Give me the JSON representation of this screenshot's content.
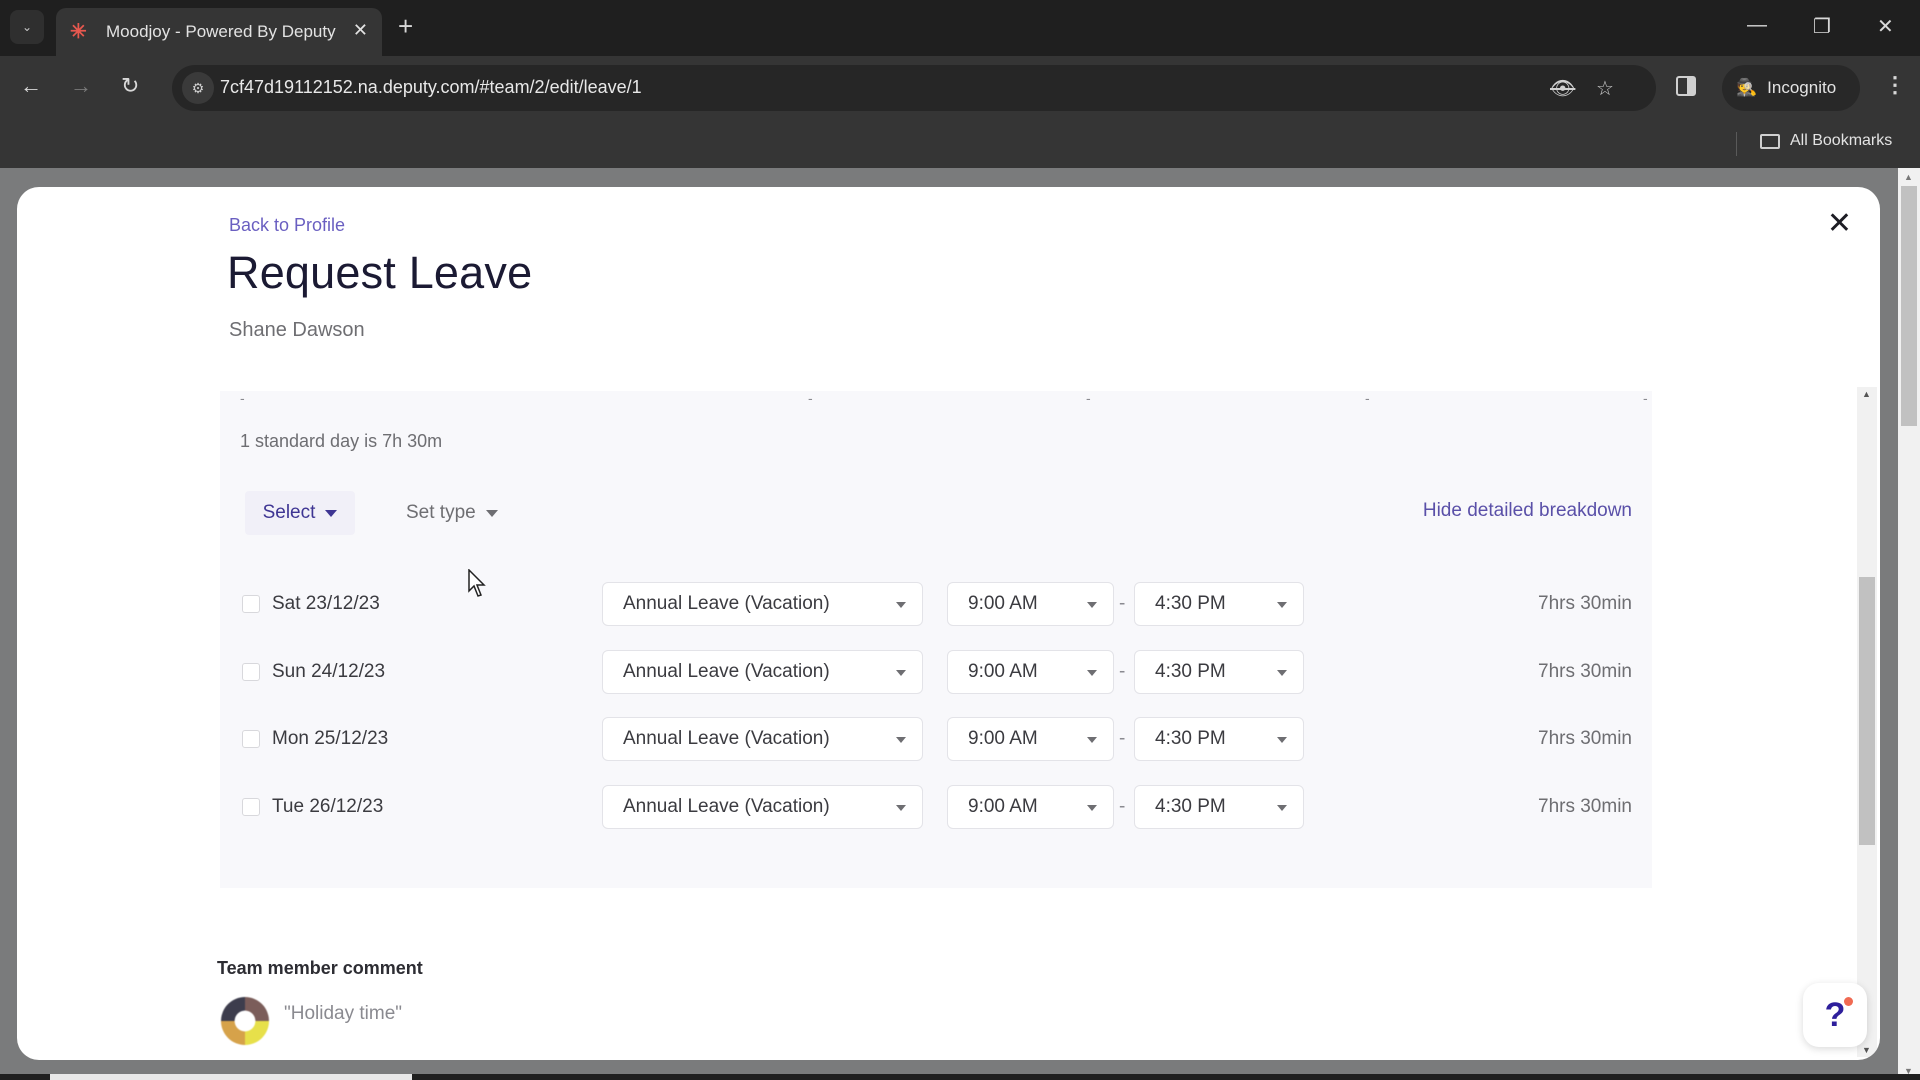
{
  "browser": {
    "tab_title": "Moodjoy - Powered By Deputy",
    "tab_favicon": "deputy-logo-icon",
    "url": "7cf47d19112152.na.deputy.com/#team/2/edit/leave/1",
    "profile_label": "Incognito",
    "bookmarks_label": "All Bookmarks",
    "icons": {
      "tab_list": "⌄",
      "favicon": "✳",
      "tab_close": "✕",
      "new_tab": "+",
      "minimize": "—",
      "restore": "❐",
      "window_close": "✕",
      "back": "←",
      "forward": "→",
      "reload": "↻",
      "site_info": "⚙",
      "eye_off": "👁",
      "star": "☆",
      "incognito": "🕵",
      "menu": "⋮"
    }
  },
  "modal": {
    "back_link": "Back to Profile",
    "title": "Request Leave",
    "employee_name": "Shane Dawson",
    "close_icon": "✕",
    "standard_day_text": "1 standard day is 7h 30m",
    "select_label": "Select",
    "set_type_label": "Set type",
    "hide_breakdown_label": "Hide detailed breakdown",
    "cut_off_row": [
      "-",
      "-",
      "-",
      "-",
      "-"
    ],
    "rows": [
      {
        "checked": false,
        "date": "Sat 23/12/23",
        "leave_type": "Annual Leave (Vacation)",
        "start": "9:00 AM",
        "end": "4:30 PM",
        "separator": "-",
        "duration": "7hrs 30min"
      },
      {
        "checked": false,
        "date": "Sun 24/12/23",
        "leave_type": "Annual Leave (Vacation)",
        "start": "9:00 AM",
        "end": "4:30 PM",
        "separator": "-",
        "duration": "7hrs 30min"
      },
      {
        "checked": false,
        "date": "Mon 25/12/23",
        "leave_type": "Annual Leave (Vacation)",
        "start": "9:00 AM",
        "end": "4:30 PM",
        "separator": "-",
        "duration": "7hrs 30min"
      },
      {
        "checked": false,
        "date": "Tue 26/12/23",
        "leave_type": "Annual Leave (Vacation)",
        "start": "9:00 AM",
        "end": "4:30 PM",
        "separator": "-",
        "duration": "7hrs 30min"
      }
    ],
    "comment_label": "Team member comment",
    "comment_text": "\"Holiday time\"",
    "help_label": "?"
  },
  "colors": {
    "accent": "#5a50a8",
    "title": "#1b1a33",
    "help_dot": "#f06a52"
  }
}
